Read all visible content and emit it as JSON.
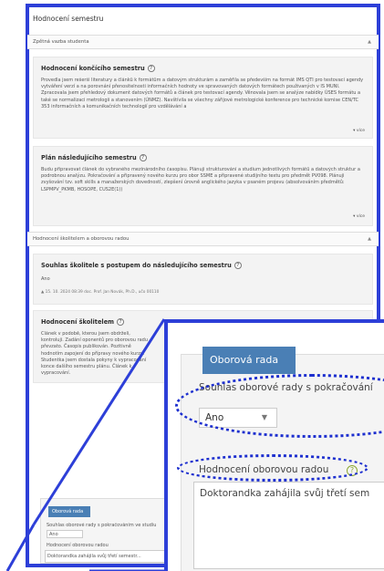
{
  "page": {
    "title": "Hodnocení semestru"
  },
  "sections": {
    "feedback": "Zpětná vazba studenta",
    "supervisor": "Hodnocení školitelem a oborovou radou"
  },
  "cards": {
    "current": {
      "title": "Hodnocení končícího semestru",
      "text": "Provedla jsem rešerši literatury a článků k formátům a datovým strukturám a zaměřila se především na formát IMS QTI pro testovací agendy vytváření verzí a na porovnání přenositelnosti informačních hodnoty ve spravovaných datových formátech použivaných v IS MUNI. Zpracovala jsem přehledový dokument datových formátů a článek pro testovací agendy. Věnovala jsem se analýze nabídky ÚSES formátu a také se normalizaci metrologii a stanovením (ÚNMZ). Navštívila se všechny zářijové metrologické konference pro technické komise CEN/TC 353 informačních a komunikačních technologií pro vzdělávání a",
      "more": "▾ více"
    },
    "next": {
      "title": "Plán následujícího semestru",
      "text": "Budu připravovat článek do vybraného mezinárodního časopisu. Plánuji strukturování a studium jednotlivých formátů a datových struktur a podrobnou analýzu. Pokračování a připravený nového kurzu pro obor SSME a připravené studijního textu pro předmět PV098. Plánuji zvyšování tzv. soft skills a manažerských dovedností, zlepšení úrovně anglického jazyka v psaném projevu (absolvováním předmětů: LSPMPV_PKMB, HOSOPE, CUS2E(1))",
      "more": "▾ více"
    },
    "agree": {
      "title": "Souhlas školitele s postupem do následujícího semestru",
      "value": "Ano",
      "meta": "▲ 15. 10. 2024 08:39 doc. Prof. Jan Novák, Ph.D., učo 00110"
    },
    "supervisor_eval": {
      "title": "Hodnocení školitelem",
      "text": "Článek v podobě, kterou jsem obdrželi, kontroluji. Zadání oponentů pro oborovou radu převzato. Časopis publikován. Pozitivně hodnotím zapojení do přípravy nového kurzu. Studentka jsem dostala pokyny k vypracování konce dalšího semestru plánu. Článek k vypracování."
    }
  },
  "board_small": {
    "button": "Oborová rada",
    "label1": "Souhlas oborové rady s pokračováním ve studiu",
    "select": "Ano",
    "label2": "Hodnocení oborovou radou",
    "textarea": "Doktorandka zahájila svůj třetí semestr..."
  },
  "zoom": {
    "button": "Oborová rada",
    "label1": "Souhlas oborové rady s pokračování",
    "select": "Ano",
    "label2": "Hodnocení oborovou radou",
    "textarea": "Doktorandka zahájila svůj třetí sem"
  },
  "icons": {
    "help": "?",
    "chevron_up": "▲",
    "chevron_down": "▼"
  },
  "colors": {
    "highlight": "#2d3fd8",
    "button": "#4a7fb5",
    "help_green": "#8aa72f"
  }
}
